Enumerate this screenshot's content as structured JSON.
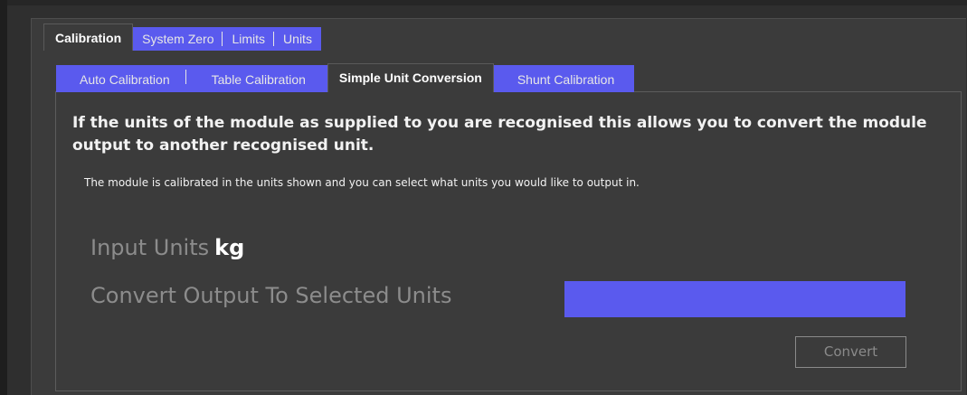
{
  "outer_tabs": [
    {
      "label": "Calibration",
      "active": true
    },
    {
      "label": "System Zero",
      "active": false
    },
    {
      "label": "Limits",
      "active": false
    },
    {
      "label": "Units",
      "active": false
    }
  ],
  "inner_tabs": [
    {
      "label": "Auto Calibration",
      "active": false
    },
    {
      "label": "Table Calibration",
      "active": false
    },
    {
      "label": "Simple Unit Conversion",
      "active": true
    },
    {
      "label": "Shunt Calibration",
      "active": false
    }
  ],
  "content": {
    "heading": "If the units of the module as supplied to you are recognised this allows you to convert the module output to another recognised unit.",
    "subtext": "The module is calibrated in the units shown and you can select  what units you would like to output in.",
    "input_units_label": "Input Units",
    "input_units_value": "kg",
    "convert_label": "Convert Output To Selected Units",
    "selected_units": "",
    "convert_button": "Convert"
  },
  "colors": {
    "tab_blue": "#5a5aee",
    "background": "#3b3b3b",
    "disabled_text": "#8c8c8c"
  }
}
